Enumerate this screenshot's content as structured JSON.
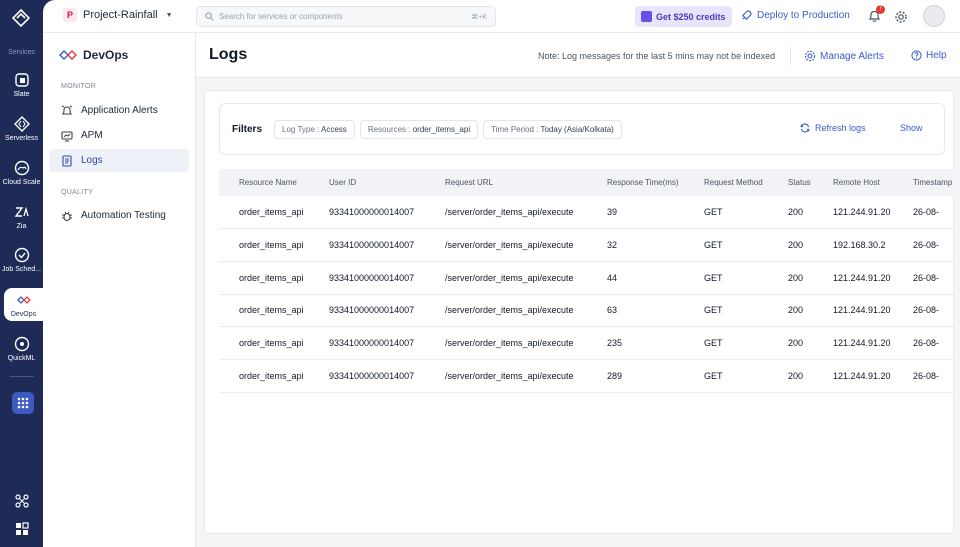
{
  "rail": {
    "services_label": "Services",
    "items": [
      {
        "label": "Slate",
        "icon": "slate-icon"
      },
      {
        "label": "Serverless",
        "icon": "serverless-icon"
      },
      {
        "label": "Cloud Scale",
        "icon": "cloud-scale-icon"
      },
      {
        "label": "Zia",
        "icon": "zia-icon"
      },
      {
        "label": "Job Sched...",
        "icon": "job-scheduling-icon"
      },
      {
        "label": "DevOps",
        "icon": "devops-icon"
      },
      {
        "label": "QuickML",
        "icon": "quickml-icon"
      }
    ],
    "active": "DevOps"
  },
  "topbar": {
    "project_initial": "P",
    "project_name": "Project-Rainfall",
    "search_placeholder": "Search for services or components",
    "search_shortcut": "⌘+K",
    "credits_label": "Get $250 credits",
    "deploy_label": "Deploy to Production",
    "notification_count": "7"
  },
  "sidebar": {
    "title": "DevOps",
    "sections": [
      {
        "label": "MONITOR",
        "items": [
          "Application Alerts",
          "APM",
          "Logs"
        ]
      },
      {
        "label": "QUALITY",
        "items": [
          "Automation Testing"
        ]
      }
    ],
    "active_item": "Logs"
  },
  "page": {
    "title": "Logs",
    "note": "Note: Log messages for the last 5 mins may not be indexed",
    "manage_alerts": "Manage Alerts",
    "help": "Help"
  },
  "filters": {
    "label": "Filters",
    "chips": [
      {
        "key": "Log Type :",
        "value": "Access"
      },
      {
        "key": "Resources :",
        "value": "order_items_api"
      },
      {
        "key": "Time Period :",
        "value": "Today (Asia/Kolkata)"
      }
    ],
    "refresh": "Refresh logs",
    "show": "Show"
  },
  "table": {
    "columns": [
      "Resource Name",
      "User ID",
      "Request URL",
      "Response Time(ms)",
      "Request Method",
      "Status",
      "Remote Host",
      "Timestamp"
    ],
    "rows": [
      [
        "order_items_api",
        "93341000000014007",
        "/server/order_items_api/execute",
        "39",
        "GET",
        "200",
        "121.244.91.20",
        "26-08-"
      ],
      [
        "order_items_api",
        "93341000000014007",
        "/server/order_items_api/execute",
        "32",
        "GET",
        "200",
        "192.168.30.2",
        "26-08-"
      ],
      [
        "order_items_api",
        "93341000000014007",
        "/server/order_items_api/execute",
        "44",
        "GET",
        "200",
        "121.244.91.20",
        "26-08-"
      ],
      [
        "order_items_api",
        "93341000000014007",
        "/server/order_items_api/execute",
        "63",
        "GET",
        "200",
        "121.244.91.20",
        "26-08-"
      ],
      [
        "order_items_api",
        "93341000000014007",
        "/server/order_items_api/execute",
        "235",
        "GET",
        "200",
        "121.244.91.20",
        "26-08-"
      ],
      [
        "order_items_api",
        "93341000000014007",
        "/server/order_items_api/execute",
        "289",
        "GET",
        "200",
        "121.244.91.20",
        "26-08-"
      ]
    ]
  }
}
